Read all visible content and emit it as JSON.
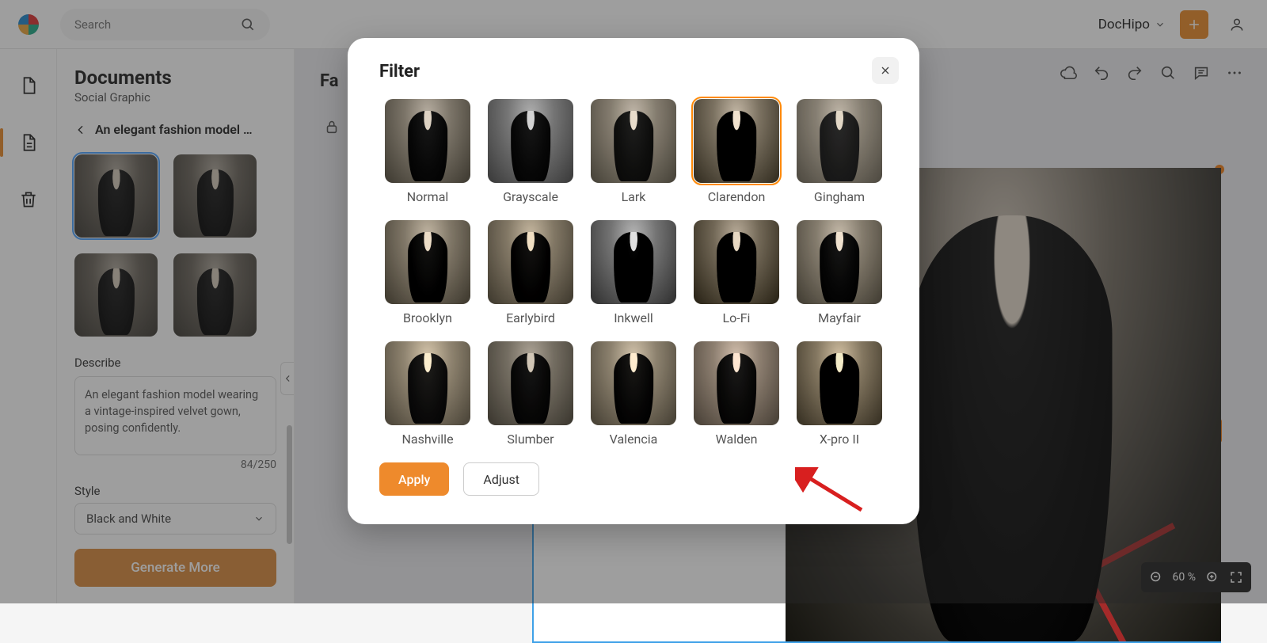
{
  "topbar": {
    "search_placeholder": "Search",
    "brand_label": "DocHipo"
  },
  "sidepanel": {
    "title": "Documents",
    "subtitle": "Social Graphic",
    "breadcrumb": "An elegant fashion model …",
    "describe_label": "Describe",
    "describe_value": "An elegant fashion model wearing a vintage-inspired velvet gown, posing confidently.",
    "char_count": "84/250",
    "style_label": "Style",
    "style_value": "Black and White",
    "generate_label": "Generate More"
  },
  "canvas": {
    "doc_title": "Fa"
  },
  "zoom": {
    "value": "60 %"
  },
  "modal": {
    "title": "Filter",
    "apply_label": "Apply",
    "adjust_label": "Adjust",
    "selected": "Clarendon",
    "filters": [
      {
        "label": "Normal",
        "cls": "f-normal"
      },
      {
        "label": "Grayscale",
        "cls": "f-gray"
      },
      {
        "label": "Lark",
        "cls": "f-lark"
      },
      {
        "label": "Clarendon",
        "cls": "f-clarendon"
      },
      {
        "label": "Gingham",
        "cls": "f-gingham"
      },
      {
        "label": "Brooklyn",
        "cls": "f-brooklyn"
      },
      {
        "label": "Earlybird",
        "cls": "f-earlybird"
      },
      {
        "label": "Inkwell",
        "cls": "f-inkwell"
      },
      {
        "label": "Lo-Fi",
        "cls": "f-lofi"
      },
      {
        "label": "Mayfair",
        "cls": "f-mayfair"
      },
      {
        "label": "Nashville",
        "cls": "f-nashville"
      },
      {
        "label": "Slumber",
        "cls": "f-slumber"
      },
      {
        "label": "Valencia",
        "cls": "f-valencia"
      },
      {
        "label": "Walden",
        "cls": "f-walden"
      },
      {
        "label": "X-pro II",
        "cls": "f-xpro"
      }
    ]
  }
}
